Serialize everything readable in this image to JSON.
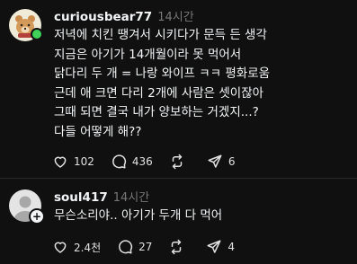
{
  "posts": [
    {
      "username": "curiousbear77",
      "time": "14시간",
      "lines": [
        "저녁에 치킨 땡겨서 시키다가 문득 든 생각",
        "지금은 아기가 14개월이라 못 먹어서",
        "닭다리 두 개 = 나랑 와이프 ㅋㅋ 평화로움",
        "근데 애 크면 다리 2개에 사람은 셋이잖아",
        "그때 되면 결국 내가 양보하는 거겠지...?",
        "다들 어떻게 해??"
      ],
      "actions": {
        "likes": "102",
        "comments": "436",
        "reposts": "",
        "shares": "6"
      }
    },
    {
      "username": "soul417",
      "time": "14시간",
      "lines": [
        "무슨소리야.. 아기가 두개 다 먹어"
      ],
      "actions": {
        "likes": "2.4천",
        "comments": "27",
        "reposts": "",
        "shares": "4"
      }
    }
  ],
  "colors": {
    "background": "#101010",
    "text": "#f3f5f7",
    "muted": "#777777",
    "online": "#3fd15a"
  },
  "icons": [
    "heart-icon",
    "comment-icon",
    "repost-icon",
    "share-icon",
    "bear-avatar",
    "default-avatar"
  ]
}
